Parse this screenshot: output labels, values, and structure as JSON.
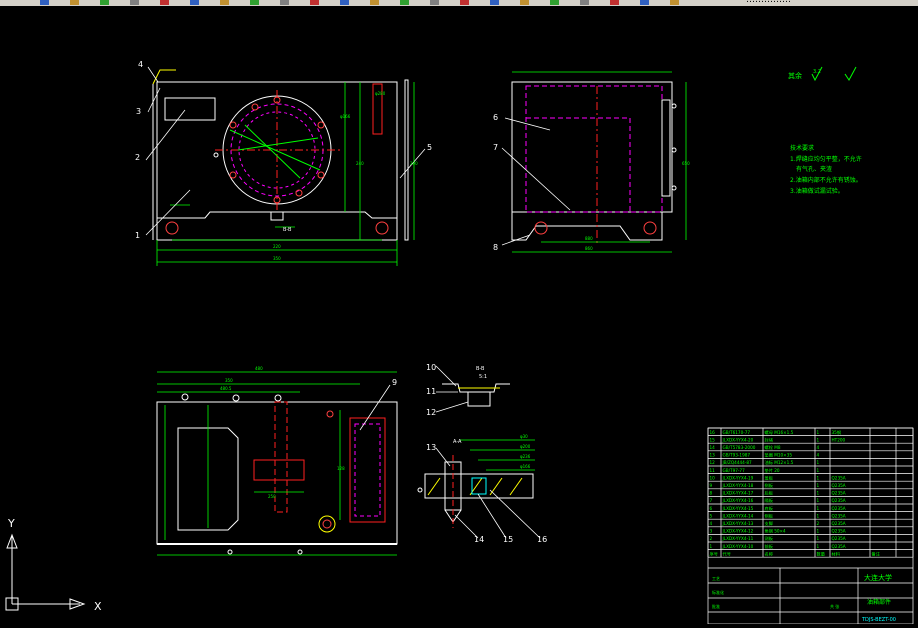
{
  "toolbar": {
    "truncated_text": "……………",
    "icons": [
      "new-file-icon",
      "open-file-icon",
      "save-icon",
      "print-icon",
      "preview-icon",
      "cut-icon",
      "copy-icon",
      "paste-icon",
      "match-properties-icon",
      "undo-icon",
      "redo-icon",
      "pan-icon",
      "zoom-realtime-icon",
      "zoom-window-icon",
      "zoom-previous-icon",
      "properties-icon",
      "design-center-icon",
      "tool-palettes-icon",
      "sheet-set-icon",
      "markup-icon",
      "calculator-icon",
      "help-icon"
    ]
  },
  "drawing": {
    "callouts": [
      "1",
      "2",
      "3",
      "4",
      "5",
      "6",
      "7",
      "8",
      "9",
      "10",
      "11",
      "12",
      "13",
      "14",
      "15",
      "16"
    ],
    "section_marks": {
      "bb_top": "B-B",
      "bb_bottom": "B-B",
      "bb_ratio": "5:1",
      "aa": "A-A",
      "bb_left": "B"
    },
    "dims_front": [
      "220",
      "350",
      "φ280",
      "φ166",
      "240",
      "290",
      "310",
      "350",
      "55",
      "66",
      "50"
    ],
    "dims_side": [
      "860",
      "880",
      "650",
      "110",
      "105",
      "112"
    ],
    "dims_top": [
      "480",
      "350",
      "480.5",
      "250",
      "50",
      "190",
      "128",
      "240",
      "320",
      "135",
      "100",
      "5",
      "166"
    ],
    "dims_detail": [
      "φ30",
      "φ200",
      "φ236",
      "φ166"
    ],
    "roughness": {
      "label": "其余",
      "value1": "3.2",
      "value2": "√"
    },
    "tech_notes": [
      "技术要求",
      "1.焊缝应均匀平整，不允许",
      "有气孔、夹渣",
      "2.油箱内部不允许有锈蚀。",
      "3.油箱做试漏试验。"
    ]
  },
  "title_block": {
    "rows": [
      {
        "no": "16",
        "code": "GB/T6170-77",
        "name": "螺母 M16×1.5",
        "qty": "1",
        "material": "35钢",
        "note": ""
      },
      {
        "no": "15",
        "code": "JLXDX-YYX4-20",
        "name": "封堵",
        "qty": "1",
        "material": "HT200",
        "note": ""
      },
      {
        "no": "14",
        "code": "GB/T5783-2000",
        "name": "螺栓 M8",
        "qty": "4",
        "material": "",
        "note": ""
      },
      {
        "no": "13",
        "code": "GB/T93-1987",
        "name": "垫圈 M10×35",
        "qty": "4",
        "material": "",
        "note": ""
      },
      {
        "no": "12",
        "code": "JB/ZQ4444-87",
        "name": "油标 M12×1.5",
        "qty": "1",
        "material": "",
        "note": ""
      },
      {
        "no": "11",
        "code": "GB/T97-77",
        "name": "垫片 20",
        "qty": "1",
        "material": "",
        "note": ""
      },
      {
        "no": "10",
        "code": "JLXDX-YYX4-19",
        "name": "盖板",
        "qty": "1",
        "material": "Q235A",
        "note": ""
      },
      {
        "no": "9",
        "code": "JLXDX-YYX4-18",
        "name": "侧板",
        "qty": "1",
        "material": "Q235A",
        "note": ""
      },
      {
        "no": "8",
        "code": "JLXDX-YYX4-17",
        "name": "后板",
        "qty": "1",
        "material": "Q235A",
        "note": ""
      },
      {
        "no": "7",
        "code": "JLXDX-YYX4-16",
        "name": "隔板",
        "qty": "1",
        "material": "Q235A",
        "note": ""
      },
      {
        "no": "6",
        "code": "JLXDX-YYX4-15",
        "name": "底板",
        "qty": "1",
        "material": "Q235A",
        "note": ""
      },
      {
        "no": "5",
        "code": "JLXDX-YYX4-14",
        "name": "侧板",
        "qty": "1",
        "material": "Q235A",
        "note": ""
      },
      {
        "no": "4",
        "code": "JLXDX-YYX4-13",
        "name": "支脚",
        "qty": "2",
        "material": "Q235A",
        "note": ""
      },
      {
        "no": "3",
        "code": "JLXDX-YYX4-12",
        "name": "角钢 50×4",
        "qty": "1",
        "material": "Q235A",
        "note": ""
      },
      {
        "no": "2",
        "code": "JLXDX-YYX4-11",
        "name": "测板",
        "qty": "1",
        "material": "Q235A",
        "note": ""
      },
      {
        "no": "1",
        "code": "JLXDX-YYX4-10",
        "name": "前板",
        "qty": "1",
        "material": "Q235A",
        "note": ""
      }
    ],
    "header": {
      "no": "序号",
      "code": "代号",
      "name": "名称",
      "qty": "数量",
      "material": "材料",
      "note": "备注"
    },
    "school": "大连大学",
    "drawing_name": "油箱部件",
    "drawing_code": "TDJS-BEZT-00",
    "misc_labels": [
      "工艺",
      "标准化",
      "批准",
      "共 张"
    ]
  },
  "ucs": {
    "y_label": "Y",
    "x_label": "X"
  },
  "colors": {
    "line": "#ffffff",
    "center": "#ff2020",
    "dim": "#00ff00",
    "hidden": "#ff00ff",
    "toolbar_bg": "#d4d0c8",
    "background": "#000000"
  }
}
